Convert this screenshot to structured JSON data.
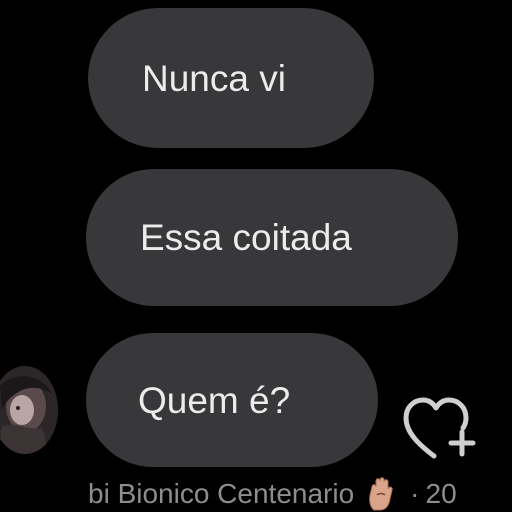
{
  "messages": [
    {
      "text": "Nunca vi"
    },
    {
      "text": "Essa coitada"
    },
    {
      "text": "Quem é?"
    }
  ],
  "footer": {
    "name": "bi Bionico Centenario",
    "separator": "·",
    "time": "20"
  },
  "icons": {
    "react": "heart-plus-icon",
    "emoji": "hand-emoji-icon",
    "avatar": "avatar"
  },
  "colors": {
    "background": "#000000",
    "bubble": "#38383b",
    "bubble_text": "#ececec",
    "footer_text": "#8d8d90"
  }
}
